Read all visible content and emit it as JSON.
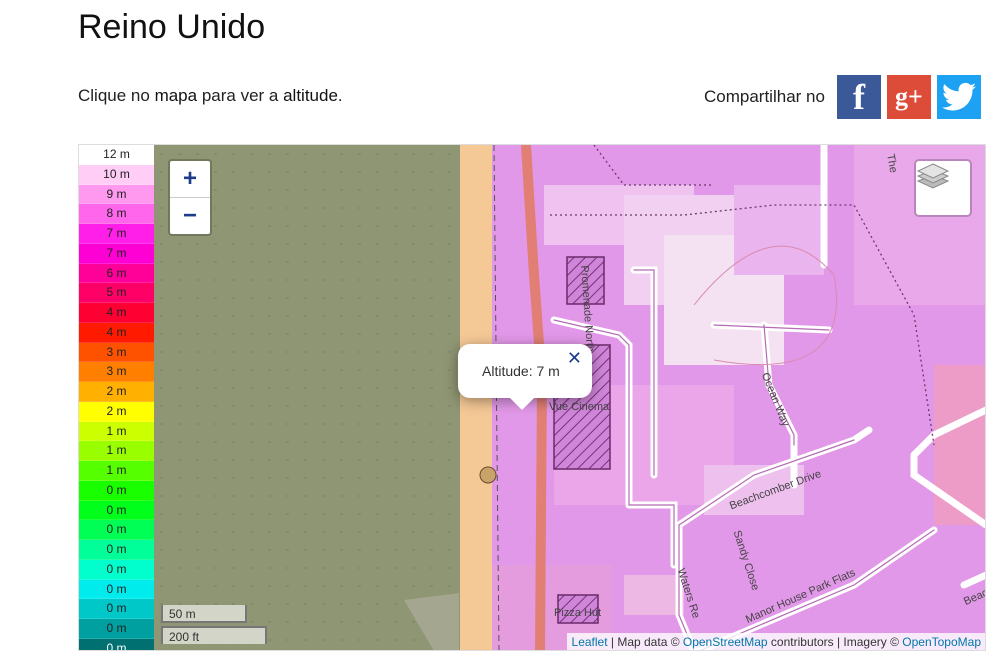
{
  "page": {
    "title": "Reino Unido",
    "intro": {
      "part1": "Clique no ",
      "bold1": "mapa",
      "part2": " para ver a ",
      "bold2": "altitude",
      "part3": "."
    },
    "share_label": "Compartilhar no",
    "social": [
      {
        "name": "facebook",
        "glyph": "f",
        "color": "#3b5998"
      },
      {
        "name": "google-plus",
        "glyph": "g+",
        "color": "#dd4b39"
      },
      {
        "name": "twitter",
        "glyph": "twitter-bird-icon",
        "color": "#1da1f2"
      }
    ]
  },
  "legend": [
    {
      "label": "12 m",
      "color": "#ffffff"
    },
    {
      "label": "10 m",
      "color": "#ffcdf6"
    },
    {
      "label": "9 m",
      "color": "#ff99f0"
    },
    {
      "label": "8 m",
      "color": "#ff66ec"
    },
    {
      "label": "7 m",
      "color": "#ff1fe8"
    },
    {
      "label": "7 m",
      "color": "#ff00d4"
    },
    {
      "label": "6 m",
      "color": "#ff0099"
    },
    {
      "label": "5 m",
      "color": "#ff0066"
    },
    {
      "label": "4 m",
      "color": "#ff0033"
    },
    {
      "label": "4 m",
      "color": "#ff1a00"
    },
    {
      "label": "3 m",
      "color": "#ff5200"
    },
    {
      "label": "3 m",
      "color": "#ff8000"
    },
    {
      "label": "2 m",
      "color": "#ffb000"
    },
    {
      "label": "2 m",
      "color": "#ffff00"
    },
    {
      "label": "1 m",
      "color": "#ccff00"
    },
    {
      "label": "1 m",
      "color": "#99ff00"
    },
    {
      "label": "1 m",
      "color": "#55ff00"
    },
    {
      "label": "0 m",
      "color": "#1aff00"
    },
    {
      "label": "0 m",
      "color": "#00ff1a"
    },
    {
      "label": "0 m",
      "color": "#00ff55"
    },
    {
      "label": "0 m",
      "color": "#00ff99"
    },
    {
      "label": "0 m",
      "color": "#00ffcc"
    },
    {
      "label": "0 m",
      "color": "#00ecec"
    },
    {
      "label": "0 m",
      "color": "#00c8c8"
    },
    {
      "label": "0 m",
      "color": "#00a0a0"
    },
    {
      "label": "0 m",
      "color": "#007070"
    },
    {
      "label": "0 m",
      "color": "#004040"
    },
    {
      "label": "0 m",
      "color": "#000000"
    }
  ],
  "map": {
    "zoom_in": "+",
    "zoom_out": "−",
    "popup": {
      "text": "Altitude: 7 m",
      "close": "✕"
    },
    "labels": {
      "promenade": "Promenade North",
      "vue": "Vue Cinema",
      "ocean": "Ocean Way",
      "beachcomber": "Beachcomber Drive",
      "sandy": "Sandy Close",
      "waters": "Waters Re",
      "manor": "Manor House Park Flats",
      "pizza": "Pizza Hut",
      "beac": "Beac",
      "the": "The"
    },
    "scale_m": "50 m",
    "scale_ft": "200 ft",
    "attribution": {
      "leaflet": "Leaflet",
      "mid1": " | Map data © ",
      "osm": "OpenStreetMap",
      "mid2": " contributors | Imagery © ",
      "otm": "OpenTopoMap"
    }
  }
}
